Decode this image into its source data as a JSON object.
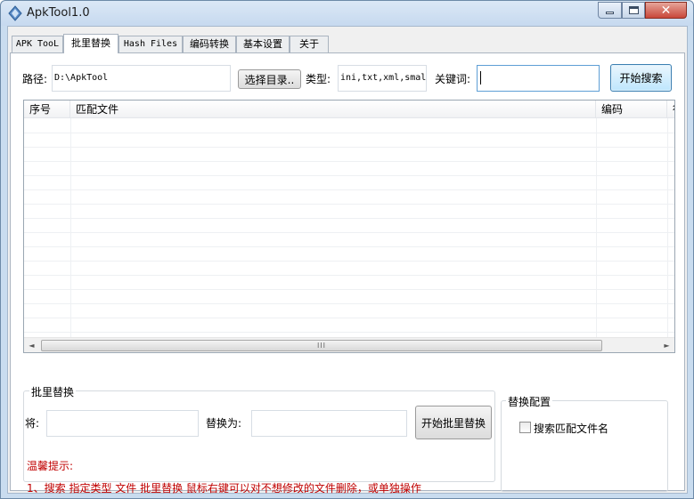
{
  "window": {
    "title": "ApkTool1.0",
    "close_glyph": "✕"
  },
  "tabs": [
    {
      "label": "APK TooL",
      "active": false
    },
    {
      "label": "批里替换",
      "active": true
    },
    {
      "label": "Hash Files",
      "active": false
    },
    {
      "label": "编码转换",
      "active": false
    },
    {
      "label": "基本设置",
      "active": false
    },
    {
      "label": "关于",
      "active": false
    }
  ],
  "search": {
    "path_label": "路径:",
    "path_value": "D:\\ApkTool",
    "browse_label": "选择目录..",
    "type_label": "类型:",
    "type_value": "ini,txt,xml,smal",
    "keyword_label": "关键词:",
    "keyword_value": "",
    "search_button": "开始搜索"
  },
  "table": {
    "columns": [
      "序号",
      "匹配文件",
      "编码",
      "行"
    ],
    "rows": [],
    "scrollbar_grip": "III",
    "scroll_left": "◄",
    "scroll_right": "►"
  },
  "replace": {
    "group_title": "批里替换",
    "from_label": "将:",
    "from_value": "",
    "to_label": "替换为:",
    "to_value": "",
    "button": "开始批里替换"
  },
  "config": {
    "group_title": "替换配置",
    "checkbox_label": "搜索匹配文件名",
    "checked": false
  },
  "tips": {
    "heading": "温馨提示:",
    "line1": "1、搜索 指定类型 文件 批里替换 鼠标右键可以对不想修改的文件删除，或单独操作"
  },
  "icons": [
    "app-icon",
    "minimize-icon",
    "maximize-icon",
    "close-icon"
  ]
}
